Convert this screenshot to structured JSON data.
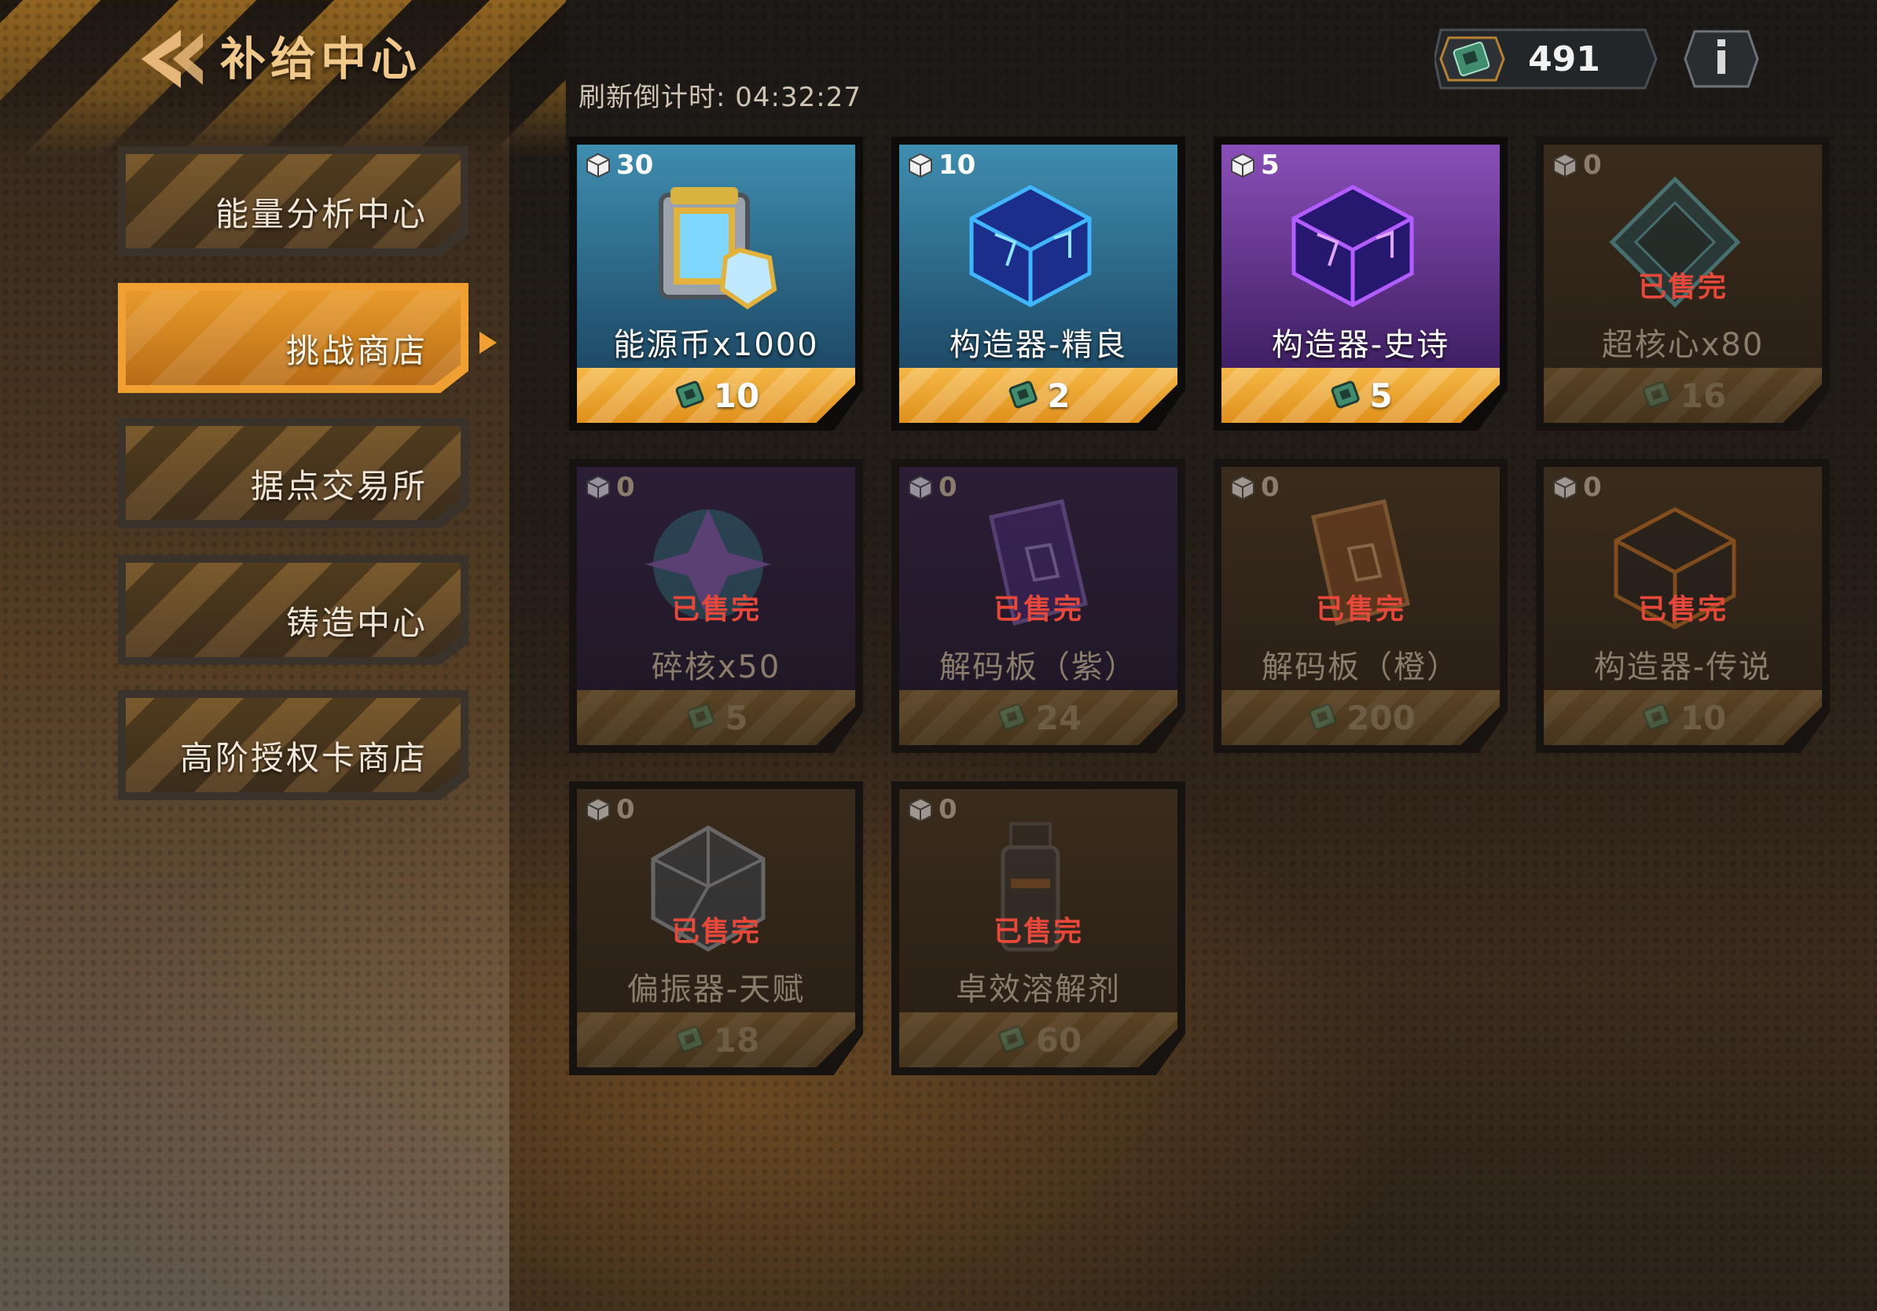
{
  "header": {
    "title": "补给中心",
    "refresh_label": "刷新倒计时: 04:32:27",
    "currency_value": "491",
    "info_icon": "info-icon",
    "back_icon": "back-arrow-icon"
  },
  "sidebar": {
    "items": [
      {
        "label": "能量分析中心",
        "active": false
      },
      {
        "label": "挑战商店",
        "active": true
      },
      {
        "label": "据点交易所",
        "active": false
      },
      {
        "label": "铸造中心",
        "active": false
      },
      {
        "label": "高阶授权卡商店",
        "active": false
      }
    ]
  },
  "shop": {
    "sold_out_label": "已售完",
    "items": [
      {
        "name": "能源币x1000",
        "stock": "30",
        "price": "10",
        "sold_out": false,
        "icon": "energy-coin-icon"
      },
      {
        "name": "构造器-精良",
        "stock": "10",
        "price": "2",
        "sold_out": false,
        "icon": "constructor-blue-icon"
      },
      {
        "name": "构造器-史诗",
        "stock": "5",
        "price": "5",
        "sold_out": false,
        "icon": "constructor-purple-icon"
      },
      {
        "name": "超核心x80",
        "stock": "0",
        "price": "16",
        "sold_out": true,
        "icon": "super-core-icon"
      },
      {
        "name": "碎核x50",
        "stock": "0",
        "price": "5",
        "sold_out": true,
        "icon": "shard-core-icon"
      },
      {
        "name": "解码板（紫）",
        "stock": "0",
        "price": "24",
        "sold_out": true,
        "icon": "decoder-board-purple-icon"
      },
      {
        "name": "解码板（橙）",
        "stock": "0",
        "price": "200",
        "sold_out": true,
        "icon": "decoder-board-orange-icon"
      },
      {
        "name": "构造器-传说",
        "stock": "0",
        "price": "10",
        "sold_out": true,
        "icon": "constructor-legend-icon"
      },
      {
        "name": "偏振器-天赋",
        "stock": "0",
        "price": "18",
        "sold_out": true,
        "icon": "polarizer-icon"
      },
      {
        "name": "卓效溶解剂",
        "stock": "0",
        "price": "60",
        "sold_out": true,
        "icon": "solvent-icon"
      }
    ]
  },
  "colors": {
    "accent_orange": "#f0a030",
    "sold_out_red": "#e8483a",
    "card_blue": "#2f6f8f",
    "card_purple": "#6a2f9a"
  }
}
